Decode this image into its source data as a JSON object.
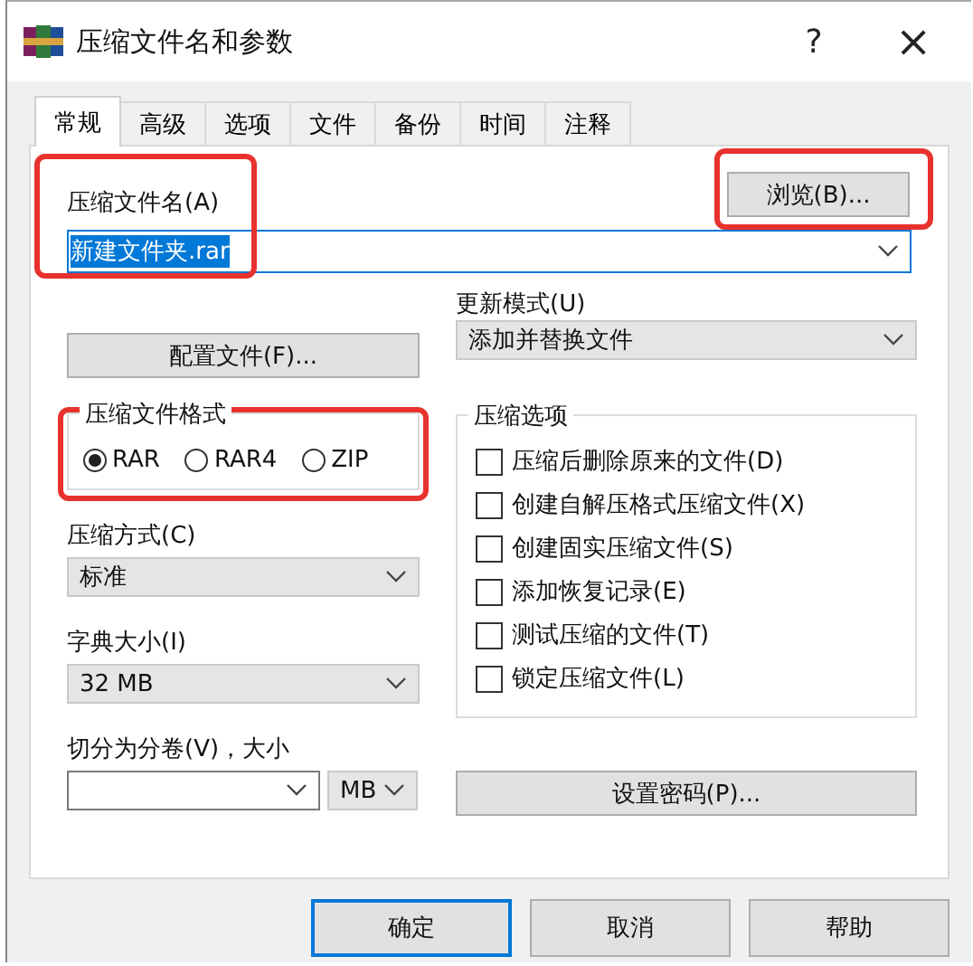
{
  "window": {
    "title": "压缩文件名和参数",
    "help": "?",
    "close": "×"
  },
  "tabs": [
    {
      "label": "常规",
      "selected": true
    },
    {
      "label": "高级",
      "selected": false
    },
    {
      "label": "选项",
      "selected": false
    },
    {
      "label": "文件",
      "selected": false
    },
    {
      "label": "备份",
      "selected": false
    },
    {
      "label": "时间",
      "selected": false
    },
    {
      "label": "注释",
      "selected": false
    }
  ],
  "archive_name": {
    "label": "压缩文件名(A)",
    "value": "新建文件夹.rar",
    "highlighted": true
  },
  "browse_button": {
    "label": "浏览(B)...",
    "highlighted": true
  },
  "profiles_button": {
    "label": "配置文件(F)..."
  },
  "update_mode": {
    "label": "更新模式(U)",
    "value": "添加并替换文件"
  },
  "archive_format": {
    "title": "压缩文件格式",
    "highlighted": true,
    "options": [
      {
        "label": "RAR",
        "selected": true
      },
      {
        "label": "RAR4",
        "selected": false
      },
      {
        "label": "ZIP",
        "selected": false
      }
    ]
  },
  "compression_method": {
    "label": "压缩方式(C)",
    "value": "标准"
  },
  "dictionary_size": {
    "label": "字典大小(I)",
    "value": "32 MB"
  },
  "split_volumes": {
    "label": "切分为分卷(V)，大小",
    "unit": "MB"
  },
  "archiving_options": {
    "title": "压缩选项",
    "items": [
      {
        "label": "压缩后删除原来的文件(D)",
        "checked": false
      },
      {
        "label": "创建自解压格式压缩文件(X)",
        "checked": false
      },
      {
        "label": "创建固实压缩文件(S)",
        "checked": false
      },
      {
        "label": "添加恢复记录(E)",
        "checked": false
      },
      {
        "label": "测试压缩的文件(T)",
        "checked": false
      },
      {
        "label": "锁定压缩文件(L)",
        "checked": false
      }
    ]
  },
  "password_button": {
    "label": "设置密码(P)..."
  },
  "buttons": [
    {
      "label": "确定",
      "default": true
    },
    {
      "label": "取消",
      "default": false
    },
    {
      "label": "帮助",
      "default": false
    }
  ]
}
